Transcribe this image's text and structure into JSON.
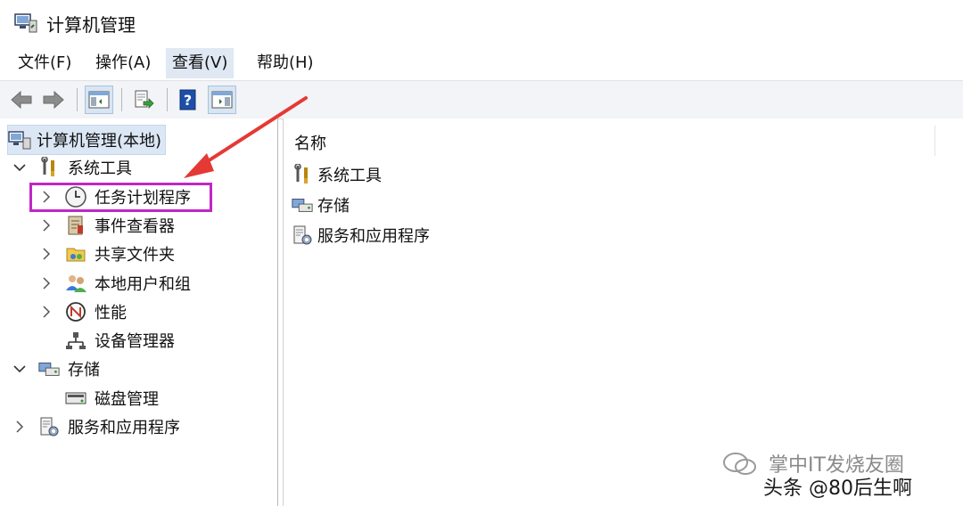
{
  "window": {
    "title": "计算机管理"
  },
  "menu": [
    {
      "label": "文件(F)"
    },
    {
      "label": "操作(A)"
    },
    {
      "label": "查看(V)",
      "active": true
    },
    {
      "label": "帮助(H)"
    }
  ],
  "toolbar": {
    "buttons": [
      "back-arrow-icon",
      "forward-arrow-icon",
      "show-hide-console-tree-icon",
      "export-list-icon",
      "help-icon",
      "show-hide-action-pane-icon"
    ]
  },
  "tree": {
    "root": "计算机管理(本地)",
    "system_tools": "系统工具",
    "task_scheduler": "任务计划程序",
    "event_viewer": "事件查看器",
    "shared_folders": "共享文件夹",
    "local_users": "本地用户和组",
    "performance": "性能",
    "device_manager": "设备管理器",
    "storage": "存储",
    "disk_management": "磁盘管理",
    "services_apps": "服务和应用程序"
  },
  "list": {
    "column_name": "名称",
    "items": [
      "系统工具",
      "存储",
      "服务和应用程序"
    ]
  },
  "watermark": {
    "line1": "掌中IT发烧友圈",
    "line2": "头条 @80后生啊"
  },
  "colors": {
    "highlight_box": "#c126c6",
    "annotation_arrow": "#e53935",
    "selected_background": "#dbe7f5"
  }
}
